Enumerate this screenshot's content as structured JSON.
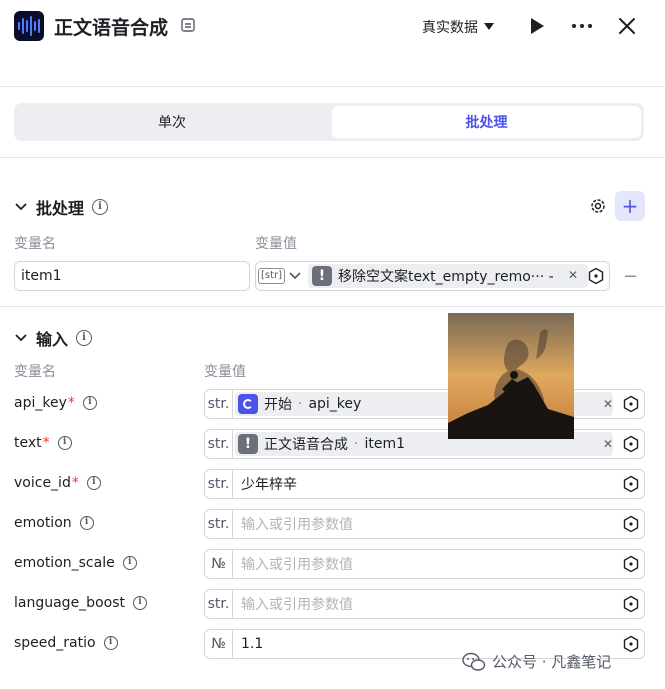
{
  "header": {
    "title": "正文语音合成",
    "data_mode": "真实数据"
  },
  "tabs": [
    {
      "label": "单次",
      "active": false
    },
    {
      "label": "批处理",
      "active": true
    }
  ],
  "batch": {
    "title": "批处理",
    "col_name": "变量名",
    "col_value": "变量值",
    "row": {
      "name": "item1",
      "type": "[str]",
      "ref": "移除空文案text_empty_remo··· -"
    }
  },
  "input": {
    "title": "输入",
    "col_name": "变量名",
    "col_value": "变量值",
    "params": [
      {
        "name": "api_key",
        "required": true,
        "type": "str.",
        "source": "开始",
        "var": "api_key",
        "kind": "ref-start"
      },
      {
        "name": "text",
        "required": true,
        "type": "str.",
        "source": "正文语音合成",
        "var": "item1",
        "kind": "ref-node"
      },
      {
        "name": "voice_id",
        "required": true,
        "type": "str.",
        "value": "少年梓辛",
        "kind": "value"
      },
      {
        "name": "emotion",
        "required": false,
        "type": "str.",
        "placeholder": "输入或引用参数值",
        "kind": "empty"
      },
      {
        "name": "emotion_scale",
        "required": false,
        "type": "№",
        "placeholder": "输入或引用参数值",
        "kind": "empty"
      },
      {
        "name": "language_boost",
        "required": false,
        "type": "str.",
        "placeholder": "输入或引用参数值",
        "kind": "empty"
      },
      {
        "name": "speed_ratio",
        "required": false,
        "type": "№",
        "value": "1.1",
        "kind": "value"
      }
    ]
  },
  "watermark": {
    "text": "公众号 · 凡鑫笔记"
  },
  "colors": {
    "accent": "#4d53e8",
    "required": "#e53935",
    "chip_bg": "#eceef2"
  }
}
